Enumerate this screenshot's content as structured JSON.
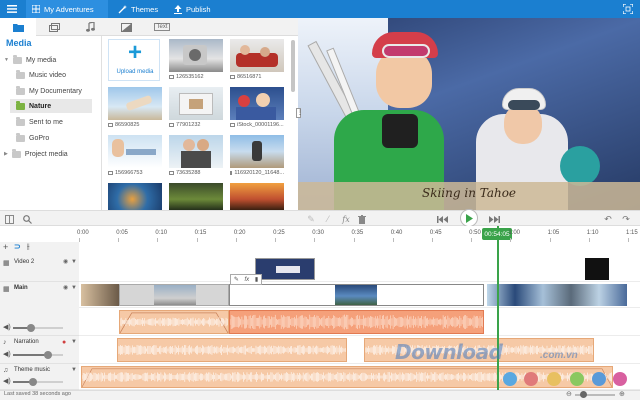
{
  "topbar": {
    "tabs": [
      {
        "label": "My Adventures",
        "icon": "grid-icon",
        "active": true
      },
      {
        "label": "Themes",
        "icon": "magic-wand-icon",
        "active": false
      },
      {
        "label": "Publish",
        "icon": "upload-icon",
        "active": false
      }
    ],
    "menu_icon": "menu-icon",
    "fullscreen_icon": "fullscreen-icon",
    "colors": {
      "bar": "#1b7fd0",
      "active_tab": "#2d8fe0"
    }
  },
  "media": {
    "tab_icons": [
      "folder-icon",
      "media-icon",
      "music-note-icon",
      "transition-icon",
      "text-icon"
    ],
    "text_tab_label": "Text",
    "heading": "Media",
    "tree": [
      {
        "label": "My media",
        "level": 0,
        "selected": false
      },
      {
        "label": "Music video",
        "level": 1,
        "selected": false
      },
      {
        "label": "My Documentary",
        "level": 1,
        "selected": false
      },
      {
        "label": "Nature",
        "level": 1,
        "selected": true
      },
      {
        "label": "Sent to me",
        "level": 1,
        "selected": false
      },
      {
        "label": "GoPro",
        "level": 1,
        "selected": false
      },
      {
        "label": "Project media",
        "level": 0,
        "selected": false
      }
    ],
    "upload_label": "Upload media",
    "thumbnails": [
      {
        "caption": "126535162"
      },
      {
        "caption": "86516871"
      },
      {
        "caption": "86590825"
      },
      {
        "caption": "77901232"
      },
      {
        "caption": "iStock_00001196..."
      },
      {
        "caption": "156966753"
      },
      {
        "caption": "73635288"
      },
      {
        "caption": "116920120_11648..."
      },
      {
        "caption": ""
      },
      {
        "caption": ""
      },
      {
        "caption": ""
      }
    ]
  },
  "preview": {
    "overlay_text": "Skiing in Tahoe"
  },
  "timeline": {
    "ruler_ticks": [
      "0:00",
      "0:05",
      "0:10",
      "0:15",
      "0:20",
      "0:25",
      "0:30",
      "0:35",
      "0:40",
      "0:45",
      "0:50",
      "1:00",
      "1:05",
      "1:10",
      "1:15"
    ],
    "playhead_time": "00:54:05",
    "tracks": [
      {
        "name": "Video 2",
        "bold": false
      },
      {
        "name": "Main",
        "bold": true
      },
      {
        "name": "Narration",
        "bold": false
      },
      {
        "name": "Theme music",
        "bold": false
      }
    ],
    "volumes": {
      "main": 0.35,
      "narration": 0.7,
      "theme_music": 0.4
    }
  },
  "toolbar": {
    "icons": [
      "scissors-icon",
      "search-icon",
      "pen-icon",
      "brush-icon",
      "fx-icon",
      "trash-icon",
      "skip-back-icon",
      "play-icon",
      "skip-forward-icon",
      "undo-icon",
      "redo-icon"
    ]
  },
  "status": {
    "text": "Last saved 38 seconds ago",
    "zoom": 0.2
  },
  "watermark": {
    "text": "Download",
    "suffix": ".com.vn"
  }
}
